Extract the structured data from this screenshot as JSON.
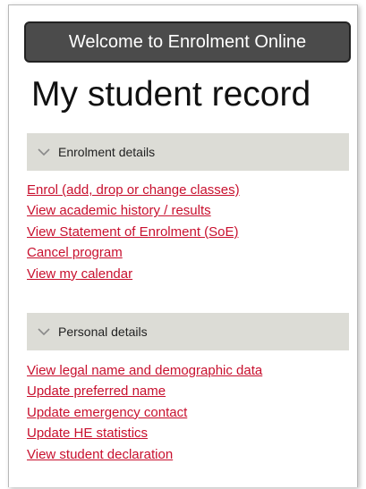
{
  "banner": {
    "label": "Welcome to Enrolment Online"
  },
  "page": {
    "title": "My student record"
  },
  "sections": [
    {
      "title": "Enrolment details",
      "icon": "chevron-down-icon",
      "links": [
        "Enrol (add, drop or change classes)",
        "View academic history / results",
        "View Statement of Enrolment (SoE)",
        "Cancel program",
        "View my calendar"
      ]
    },
    {
      "title": "Personal details",
      "icon": "chevron-down-icon",
      "links": [
        "View legal name and demographic data",
        "Update preferred name",
        "Update emergency contact",
        "Update HE statistics",
        "View student declaration"
      ]
    }
  ],
  "colors": {
    "link": "#c8102e",
    "section_header_bg": "#dcdcd6",
    "banner_bg": "#4b4b4b"
  }
}
